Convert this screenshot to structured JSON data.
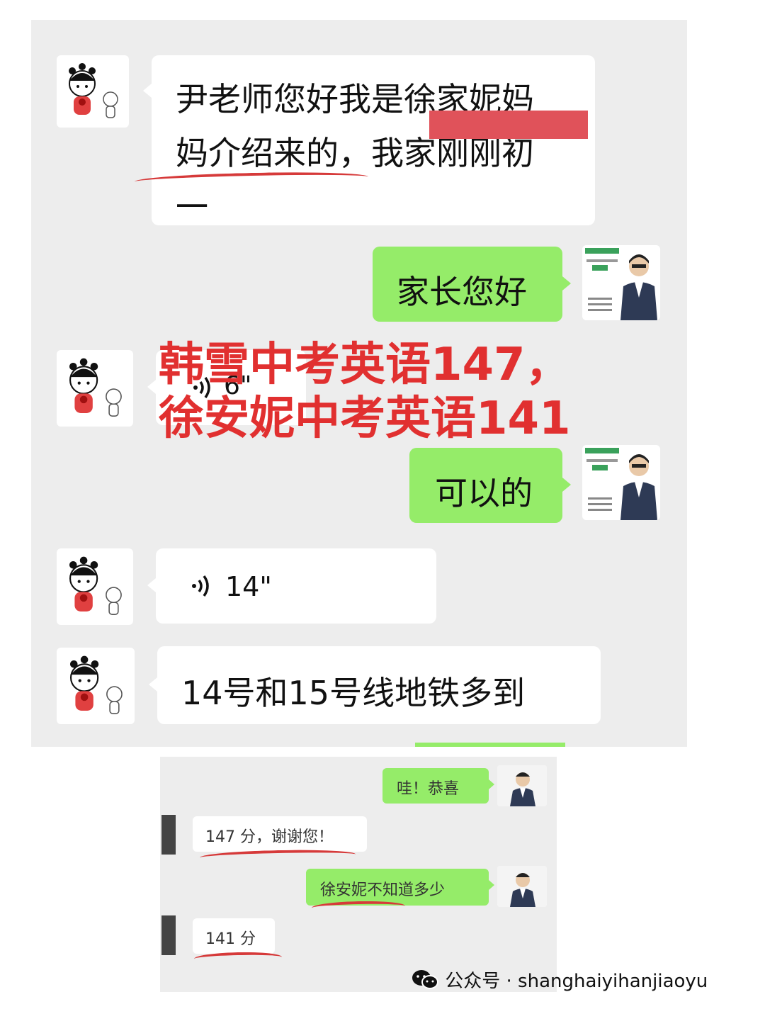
{
  "chat_top": {
    "msg1_line1": "尹老师您好我是徐家妮妈",
    "msg1_line2": "妈介绍来的，我家刚刚初",
    "msg1_line3": "一",
    "reply1": "家长您好",
    "voice1_duration": "6\"",
    "reply2": "可以的",
    "voice2_duration": "14\"",
    "msg_metro": "14号和15号线地铁多到"
  },
  "overlay": {
    "line1": "韩雪中考英语147，",
    "line2": "徐安妮中考英语141"
  },
  "chat_bottom": {
    "teacher1": "哇！恭喜",
    "parent1": "147 分，谢谢您！",
    "teacher2": "徐安妮不知道多少",
    "parent2": "141 分"
  },
  "watermark": {
    "label": "公众号 · shanghaiyihanjiaoyu"
  },
  "colors": {
    "chat_bg": "#ededed",
    "green_bubble": "#95ec69",
    "overlay_red": "#e13030",
    "redaction": "#e0525a"
  },
  "icons": [
    "girl-avatar-icon",
    "teacher-avatar-icon",
    "voice-icon",
    "wechat-logo-icon"
  ]
}
